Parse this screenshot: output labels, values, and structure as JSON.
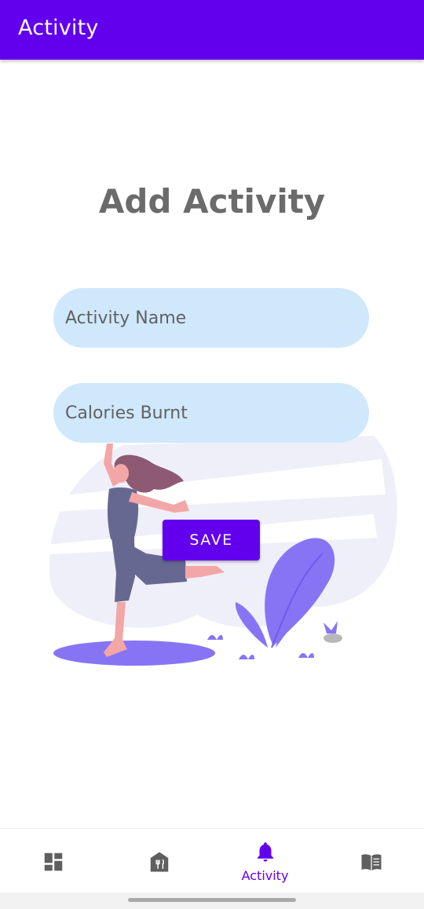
{
  "app_bar": {
    "title": "Activity"
  },
  "main": {
    "title": "Add Activity",
    "activity_name_field": {
      "placeholder": "Activity Name",
      "value": ""
    },
    "calories_field": {
      "placeholder": "Calories Burnt",
      "value": ""
    },
    "save_label": "SAVE"
  },
  "illustration": {
    "name": "dancing-woman-illustration"
  },
  "bottom_nav": {
    "items": [
      {
        "icon": "dashboard-icon",
        "label": "",
        "active": false
      },
      {
        "icon": "restaurant-icon",
        "label": "",
        "active": false
      },
      {
        "icon": "bell-icon",
        "label": "Activity",
        "active": true
      },
      {
        "icon": "book-icon",
        "label": "",
        "active": false
      }
    ]
  },
  "colors": {
    "primary": "#6200ee",
    "field_background": "#cfe8fc",
    "title_text": "#6b6b6b",
    "inactive_icon": "#5f5f5f"
  }
}
